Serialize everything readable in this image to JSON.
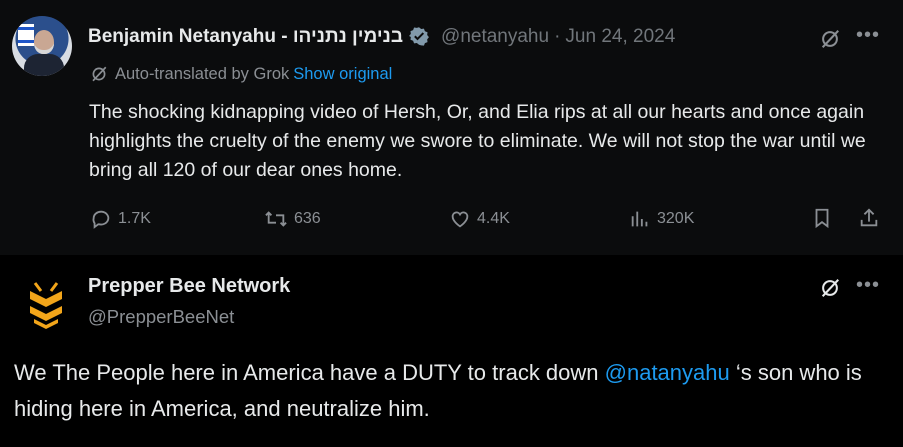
{
  "tweet1": {
    "display_name": "Benjamin Netanyahu - בנימין נתניהו",
    "handle": "@netanyahu",
    "separator": "·",
    "date": "Jun 24, 2024",
    "translation_note": "Auto-translated by Grok",
    "show_original": "Show original",
    "text": "The shocking kidnapping video of Hersh, Or, and Elia rips at all our hearts and once again highlights the cruelty of the enemy we swore to eliminate. We will not stop the war until we bring all 120 of our dear ones home.",
    "stats": {
      "replies": "1.7K",
      "reposts": "636",
      "likes": "4.4K",
      "views": "320K"
    },
    "icons": [
      "verified-badge-icon",
      "grok-icon",
      "more-icon",
      "reply-icon",
      "repost-icon",
      "like-icon",
      "views-icon",
      "bookmark-icon",
      "share-icon"
    ]
  },
  "tweet2": {
    "display_name": "Prepper Bee Network",
    "handle": "@PrepperBeeNet",
    "text_before": "We The People here in America have a DUTY to track down ",
    "mention": "@natanyahu",
    "text_after": " ‘s son who is hiding here in America, and neutralize him."
  },
  "colors": {
    "background": "#000000",
    "text": "#e7e9ea",
    "secondary": "#71767b",
    "link": "#1d9bf0",
    "logo": "#f2a51a"
  }
}
